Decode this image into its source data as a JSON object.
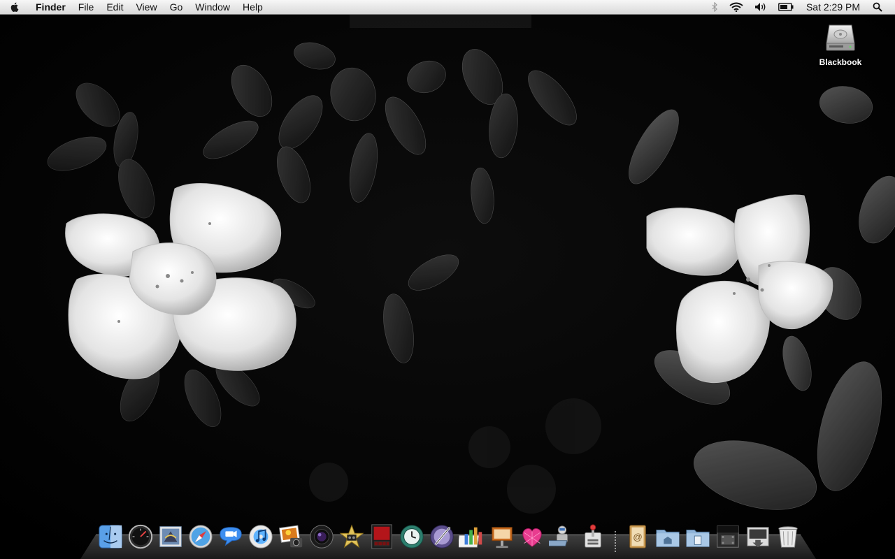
{
  "menubar": {
    "app_name": "Finder",
    "menus": [
      "File",
      "Edit",
      "View",
      "Go",
      "Window",
      "Help"
    ],
    "clock": "Sat 2:29 PM"
  },
  "desktop": {
    "icons": [
      {
        "label": "Blackbook",
        "icon": "hard-drive-icon"
      }
    ]
  },
  "dock": {
    "apps": [
      "finder-icon",
      "dashboard-icon",
      "mail-icon",
      "safari-icon",
      "ichat-icon",
      "itunes-icon",
      "iphoto-icon",
      "photo-booth-icon",
      "imovie-icon",
      "front-row-icon",
      "time-machine-icon",
      "script-editor-icon",
      "numbers-icon",
      "keynote-icon",
      "heart-app-icon",
      "automator-icon",
      "system-utility-icon"
    ],
    "stacks": [
      "address-book-icon",
      "applications-folder-icon",
      "documents-folder-icon",
      "movie-folder-icon",
      "downloads-stack-icon",
      "trash-icon"
    ]
  },
  "colors": {
    "menubar": "#e6e6e6",
    "desktop": "#000000"
  }
}
